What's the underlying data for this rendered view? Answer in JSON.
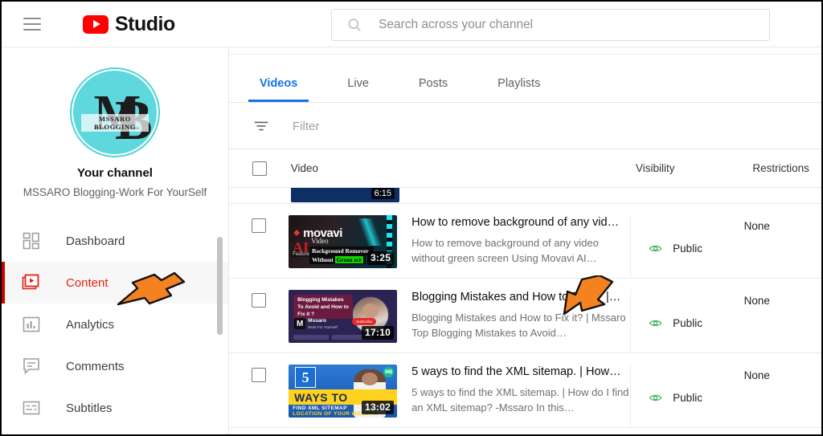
{
  "app": {
    "brand_text": "Studio",
    "menu_icon": "hamburger-icon",
    "logo_icon": "youtube-logo-icon"
  },
  "search": {
    "placeholder": "Search across your channel",
    "value": "",
    "icon": "search-icon"
  },
  "sidebar": {
    "avatar": {
      "monogram_m": "M",
      "monogram_b": "B",
      "tag": "MSSARO BLOGGING",
      "bg_color": "#5ed8dd"
    },
    "your_channel_label": "Your channel",
    "channel_name": "MSSARO Blogging-Work For YourSelf",
    "items": [
      {
        "label": "Dashboard",
        "icon": "dashboard-grid-icon",
        "active": false
      },
      {
        "label": "Content",
        "icon": "content-video-icon",
        "active": true
      },
      {
        "label": "Analytics",
        "icon": "analytics-bar-icon",
        "active": false
      },
      {
        "label": "Comments",
        "icon": "comments-bubble-icon",
        "active": false
      },
      {
        "label": "Subtitles",
        "icon": "subtitles-icon",
        "active": false
      }
    ],
    "active_color": "#e52117"
  },
  "main": {
    "tabs": [
      {
        "label": "Videos",
        "active": true
      },
      {
        "label": "Live",
        "active": false
      },
      {
        "label": "Posts",
        "active": false
      },
      {
        "label": "Playlists",
        "active": false
      }
    ],
    "tab_accent_color": "#1673e6",
    "filter": {
      "label": "Filter",
      "icon": "filter-icon"
    },
    "table": {
      "columns": [
        "Video",
        "Visibility",
        "Restrictions"
      ],
      "select_all_checkbox": "checkbox-unchecked",
      "partial_row": {
        "duration": "6:15"
      },
      "rows": [
        {
          "title": "How to remove background of any vid…",
          "description": "How to remove background of any video without green screen Using Movavi AI…",
          "duration": "3:25",
          "visibility": "Public",
          "visibility_icon": "eye-public-icon",
          "restrictions": "None",
          "thumb_style": "tn-movavi",
          "thumb_text": {
            "brand": "movavi",
            "ai": "AI",
            "video": "Video",
            "line1": "Background Remover",
            "line2": "Without",
            "highlight": "Green scr",
            "feature": "Feature"
          }
        },
        {
          "title": "Blogging Mistakes and How to Fix it? |…",
          "description": "Blogging Mistakes and How to Fix it? | Mssaro Top Blogging Mistakes to Avoid…",
          "duration": "17:10",
          "visibility": "Public",
          "visibility_icon": "eye-public-icon",
          "restrictions": "None",
          "thumb_style": "tn-blog",
          "thumb_text": {
            "headline": "Blogging Mistakes To Avoid and How to Fix it ?",
            "logo_letter": "M",
            "brand": "Mssaro",
            "tagline": "Work For YourSelf",
            "cta": "Subscribe"
          }
        },
        {
          "title": "5 ways to find the XML sitemap. | How…",
          "description": "5 ways to find the XML sitemap. | How do I find an XML sitemap? -Mssaro In this…",
          "duration": "13:02",
          "visibility": "Public",
          "visibility_icon": "eye-public-icon",
          "restrictions": "None",
          "thumb_style": "tn-xml",
          "thumb_text": {
            "number": "5",
            "ways": "WAYS TO",
            "sub1": "FIND XML SITEMAP",
            "sub2": "LOCATION OF YOUR WEBSITE",
            "badge": "MB"
          }
        }
      ]
    }
  },
  "annotations": {
    "arrow_color": "#f58220",
    "arrows": [
      {
        "name": "arrow-pointing-content-nav"
      },
      {
        "name": "arrow-pointing-video-title"
      }
    ]
  }
}
